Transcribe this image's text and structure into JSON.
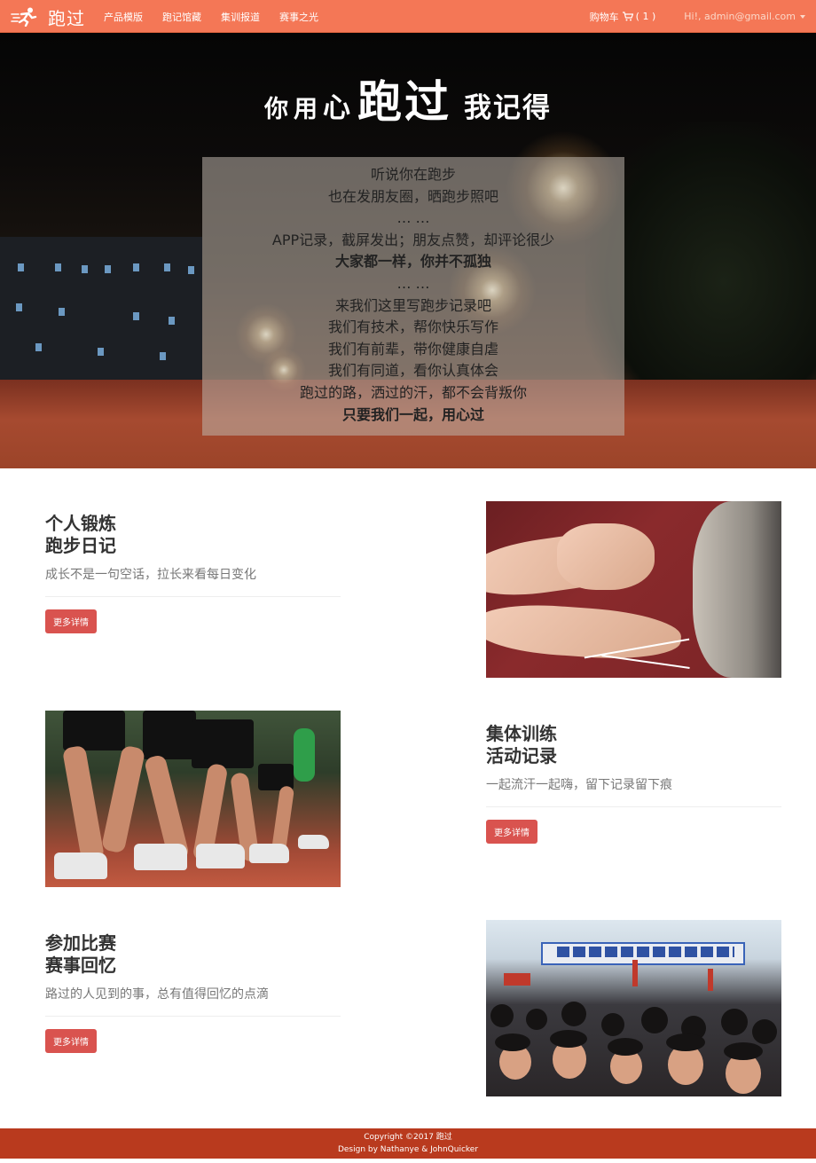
{
  "navbar": {
    "brand": "跑过",
    "links": [
      "产品模版",
      "跑记馆藏",
      "集训报道",
      "赛事之光"
    ],
    "cart_label": "购物车",
    "cart_count": "( 1 )",
    "user_label": "Hi!, admin@gmail.com",
    "colors": {
      "bar": "#f47756",
      "user_text": "#fbd7c8"
    }
  },
  "hero": {
    "title": {
      "part1": "你用",
      "part2": "心",
      "part3": "跑过",
      "part4": "我记得"
    },
    "lines": [
      "听说你在跑步",
      "也在发朋友圈，晒跑步照吧",
      "… …",
      "APP记录，截屏发出；朋友点赞，却评论很少",
      "大家都一样，你并不孤独",
      "… …",
      "来我们这里写跑步记录吧",
      "我们有技术，帮你快乐写作",
      "我们有前辈，带你健康自虐",
      "我们有同道，看你认真体会",
      "跑过的路，洒过的汗，都不会背叛你",
      "只要我们一起，用心过"
    ]
  },
  "features": [
    {
      "title_line1": "个人锻炼",
      "title_line2": "跑步日记",
      "desc": "成长不是一句空话，拉长来看每日变化",
      "button": "更多详情"
    },
    {
      "title_line1": "集体训练",
      "title_line2": "活动记录",
      "desc": "一起流汗一起嗨，留下记录留下痕",
      "button": "更多详情"
    },
    {
      "title_line1": "参加比赛",
      "title_line2": "赛事回忆",
      "desc": "路过的人见到的事，总有值得回忆的点滴",
      "button": "更多详情"
    }
  ],
  "footer": {
    "copyright": "Copyright ©2017 跑过",
    "credits": "Design by Nathanye & JohnQuicker",
    "color": "#b93a1e"
  },
  "accent_button_color": "#d9534f"
}
